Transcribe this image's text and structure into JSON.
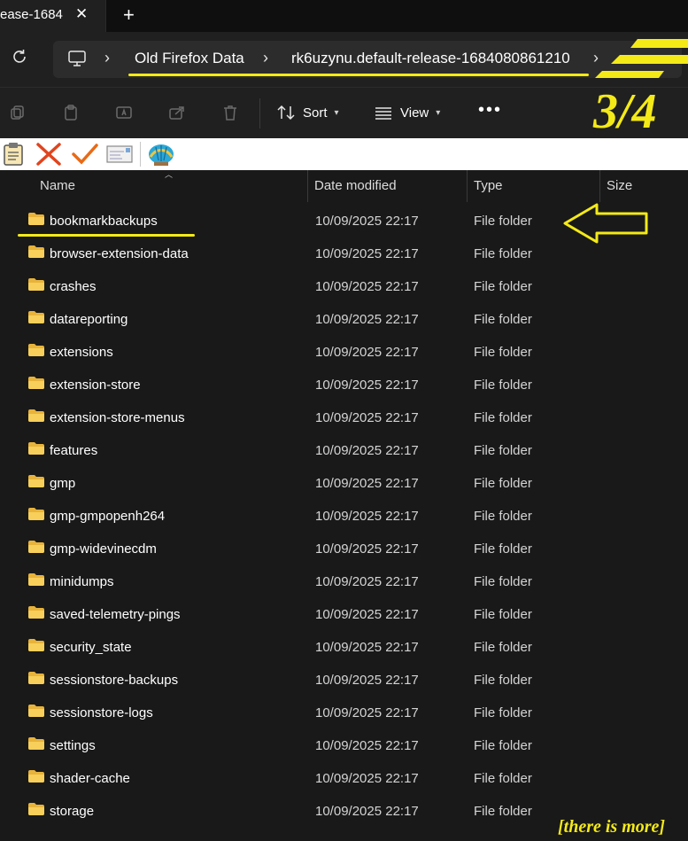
{
  "tab": {
    "title": "ease-1684",
    "close_glyph": "✕",
    "new_glyph": "+"
  },
  "address": {
    "crumbs": [
      "Old Firefox Data",
      "rk6uzynu.default-release-1684080861210"
    ],
    "separator": "›"
  },
  "commands": {
    "sort_label": "Sort",
    "view_label": "View",
    "more_label": "•••"
  },
  "annotations": {
    "step_label": "3/4",
    "more_note": "[there is more]",
    "color": "#f4ea18"
  },
  "columns": {
    "name": "Name",
    "date": "Date modified",
    "type": "Type",
    "size": "Size"
  },
  "files": [
    {
      "name": "bookmarkbackups",
      "date": "10/09/2025 22:17",
      "type": "File folder"
    },
    {
      "name": "browser-extension-data",
      "date": "10/09/2025 22:17",
      "type": "File folder"
    },
    {
      "name": "crashes",
      "date": "10/09/2025 22:17",
      "type": "File folder"
    },
    {
      "name": "datareporting",
      "date": "10/09/2025 22:17",
      "type": "File folder"
    },
    {
      "name": "extensions",
      "date": "10/09/2025 22:17",
      "type": "File folder"
    },
    {
      "name": "extension-store",
      "date": "10/09/2025 22:17",
      "type": "File folder"
    },
    {
      "name": "extension-store-menus",
      "date": "10/09/2025 22:17",
      "type": "File folder"
    },
    {
      "name": "features",
      "date": "10/09/2025 22:17",
      "type": "File folder"
    },
    {
      "name": "gmp",
      "date": "10/09/2025 22:17",
      "type": "File folder"
    },
    {
      "name": "gmp-gmpopenh264",
      "date": "10/09/2025 22:17",
      "type": "File folder"
    },
    {
      "name": "gmp-widevinecdm",
      "date": "10/09/2025 22:17",
      "type": "File folder"
    },
    {
      "name": "minidumps",
      "date": "10/09/2025 22:17",
      "type": "File folder"
    },
    {
      "name": "saved-telemetry-pings",
      "date": "10/09/2025 22:17",
      "type": "File folder"
    },
    {
      "name": "security_state",
      "date": "10/09/2025 22:17",
      "type": "File folder"
    },
    {
      "name": "sessionstore-backups",
      "date": "10/09/2025 22:17",
      "type": "File folder"
    },
    {
      "name": "sessionstore-logs",
      "date": "10/09/2025 22:17",
      "type": "File folder"
    },
    {
      "name": "settings",
      "date": "10/09/2025 22:17",
      "type": "File folder"
    },
    {
      "name": "shader-cache",
      "date": "10/09/2025 22:17",
      "type": "File folder"
    },
    {
      "name": "storage",
      "date": "10/09/2025 22:17",
      "type": "File folder"
    }
  ]
}
